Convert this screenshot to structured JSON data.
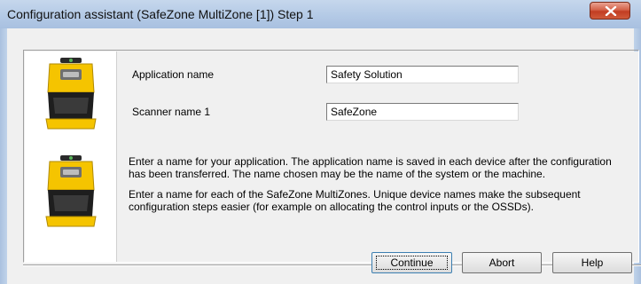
{
  "window": {
    "title": "Configuration assistant (SafeZone MultiZone [1]) Step 1"
  },
  "form": {
    "application_name_label": "Application name",
    "application_name_value": "Safety Solution",
    "scanner_name_label": "Scanner name 1",
    "scanner_name_value": "SafeZone"
  },
  "help": {
    "paragraph1_line1": "Enter a name for your application. The application name is saved in each device after the configuration",
    "paragraph1_line2": "has been transferred. The name chosen may be the name of the system or the machine.",
    "paragraph2_line1": "Enter a name for each of the SafeZone MultiZones. Unique device names make the subsequent",
    "paragraph2_line2": "configuration steps easier (for example on allocating the control inputs or the OSSDs)."
  },
  "buttons": {
    "continue": "Continue",
    "abort": "Abort",
    "help": "Help"
  },
  "icons": {
    "close": "close-icon",
    "scanner": "safety-laser-scanner-icon"
  },
  "colors": {
    "scanner_yellow": "#f5c400",
    "scanner_black": "#1e1e1e",
    "close_red": "#c8482c"
  }
}
